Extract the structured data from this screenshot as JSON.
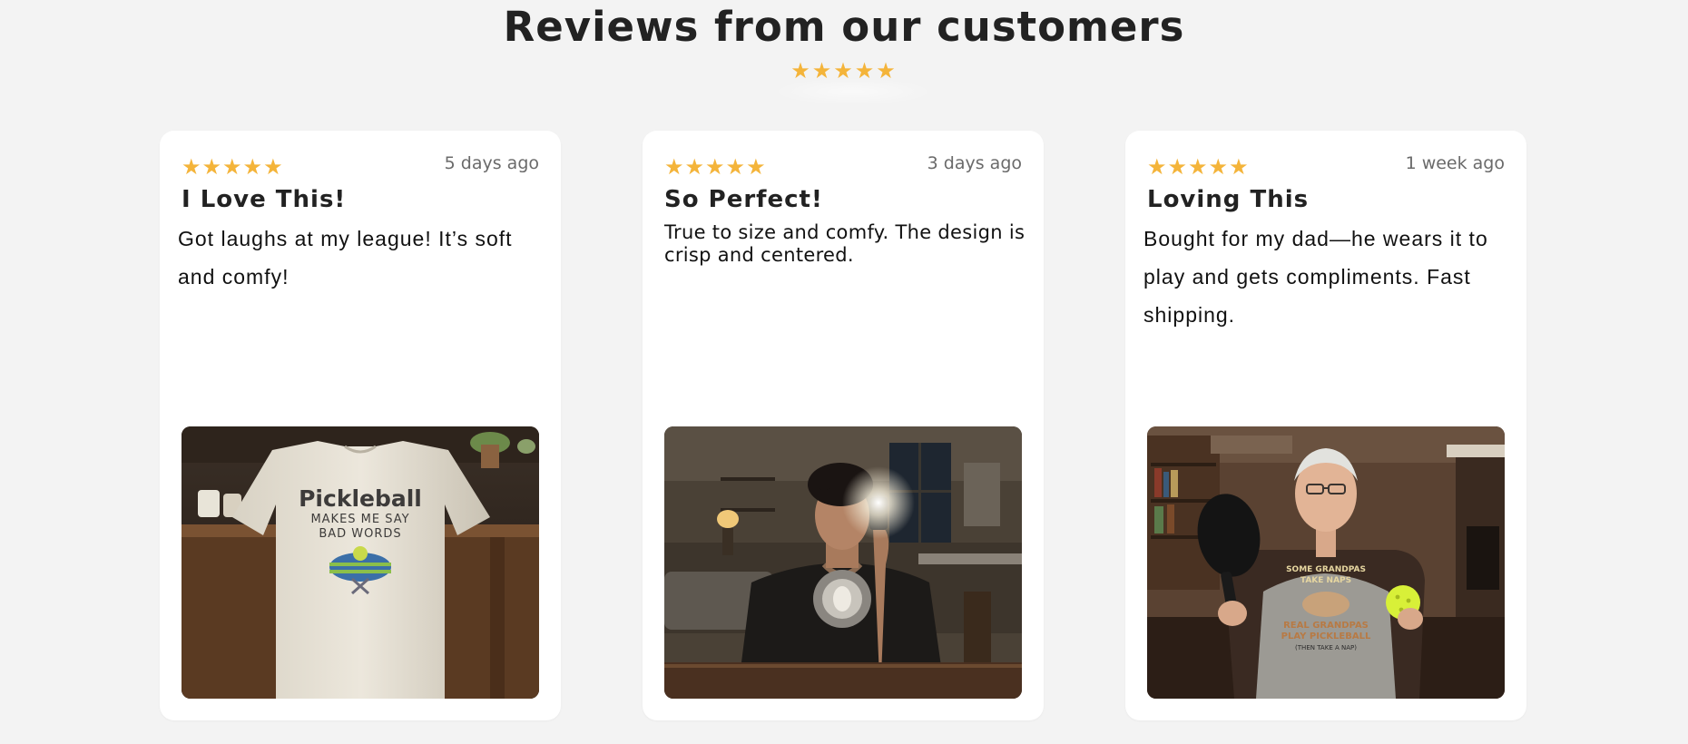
{
  "page": {
    "title": "Reviews from our customers",
    "rating_stars": "★★★★★",
    "accent_color": "#f4b43a"
  },
  "reviews": [
    {
      "stars": "★★★★★",
      "date": "5 days ago",
      "title": "I Love This!",
      "text": "Got laughs at my league! It’s soft and comfy!",
      "photo": {
        "shirt_line1": "Pickleball",
        "shirt_line2": "MAKES ME SAY",
        "shirt_line3": "BAD WORDS"
      }
    },
    {
      "stars": "★★★★★",
      "date": "3 days ago",
      "title": "So Perfect!",
      "text": "True to size and comfy. The design is crisp and centered.",
      "photo": {}
    },
    {
      "stars": "★★★★★",
      "date": "1 week ago",
      "title": "Loving This",
      "text": "Bought for my dad—he wears it to play and gets compliments. Fast shipping.",
      "photo": {
        "shirt_line1": "SOME GRANDPAS",
        "shirt_line2": "TAKE NAPS",
        "shirt_line3": "REAL GRANDPAS",
        "shirt_line4": "PLAY PICKLEBALL",
        "shirt_line5": "(THEN TAKE A NAP)"
      }
    }
  ]
}
